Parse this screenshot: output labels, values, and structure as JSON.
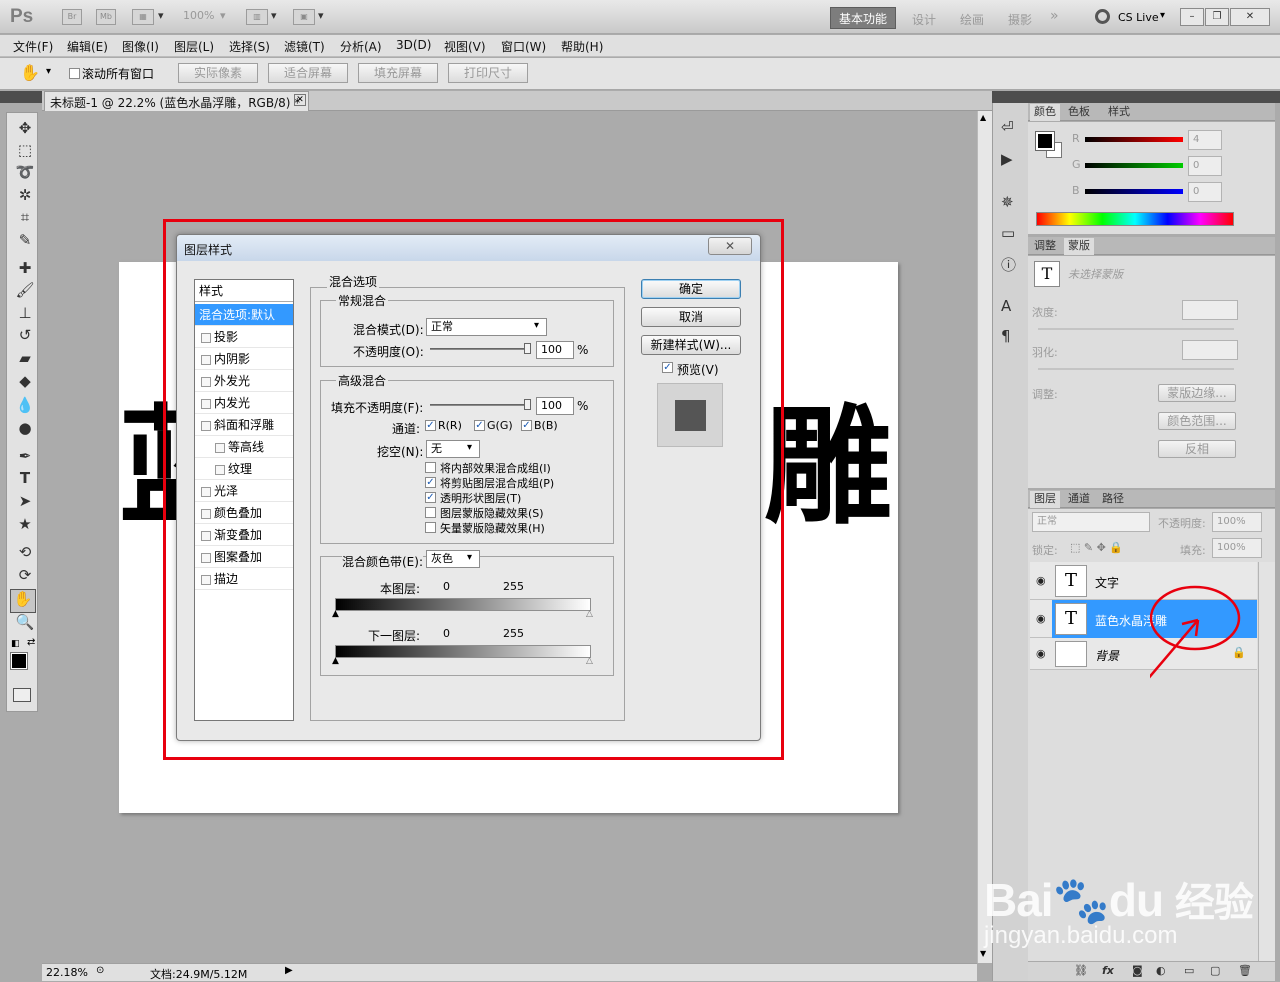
{
  "app": {
    "logo": "Ps",
    "toolbar_icons": [
      "Br",
      "Mb"
    ],
    "zoom": "100%",
    "workspaces": {
      "active": "基本功能",
      "others": [
        "设计",
        "绘画",
        "摄影",
        "»"
      ]
    },
    "cslive": "CS Live",
    "window_buttons": [
      "–",
      "❐",
      "✕"
    ]
  },
  "menu": [
    "文件(F)",
    "编辑(E)",
    "图像(I)",
    "图层(L)",
    "选择(S)",
    "滤镜(T)",
    "分析(A)",
    "3D(D)",
    "视图(V)",
    "窗口(W)",
    "帮助(H)"
  ],
  "options": {
    "scroll_all": "滚动所有窗口",
    "buttons": [
      "实际像素",
      "适合屏幕",
      "填充屏幕",
      "打印尺寸"
    ]
  },
  "document": {
    "tab": "未标题-1 @ 22.2% (蓝色水晶浮雕，RGB/8) *",
    "canvas_text_left": "蓝",
    "canvas_text_right": "雕",
    "status_zoom": "22.18%",
    "status_doc": "文档:24.9M/5.12M"
  },
  "dialog": {
    "title": "图层样式",
    "close": "✕",
    "styles_header": "样式",
    "styles": [
      {
        "label": "混合选项:默认",
        "selected": true,
        "check": false,
        "indent": false
      },
      {
        "label": "投影",
        "check": true,
        "indent": false
      },
      {
        "label": "内阴影",
        "check": true,
        "indent": false
      },
      {
        "label": "外发光",
        "check": true,
        "indent": false
      },
      {
        "label": "内发光",
        "check": true,
        "indent": false
      },
      {
        "label": "斜面和浮雕",
        "check": true,
        "indent": false
      },
      {
        "label": "等高线",
        "check": true,
        "indent": true
      },
      {
        "label": "纹理",
        "check": true,
        "indent": true
      },
      {
        "label": "光泽",
        "check": true,
        "indent": false
      },
      {
        "label": "颜色叠加",
        "check": true,
        "indent": false
      },
      {
        "label": "渐变叠加",
        "check": true,
        "indent": false
      },
      {
        "label": "图案叠加",
        "check": true,
        "indent": false
      },
      {
        "label": "描边",
        "check": true,
        "indent": false
      }
    ],
    "blend_options": "混合选项",
    "general": "常规混合",
    "blend_mode_label": "混合模式(D):",
    "blend_mode_value": "正常",
    "opacity_label": "不透明度(O):",
    "opacity_value": "100",
    "pct": "%",
    "advanced": "高级混合",
    "fill_label": "填充不透明度(F):",
    "fill_value": "100",
    "channels_label": "通道:",
    "channels": [
      "R(R)",
      "G(G)",
      "B(B)"
    ],
    "knockout_label": "挖空(N):",
    "knockout_value": "无",
    "options_checks": [
      {
        "label": "将内部效果混合成组(I)",
        "checked": false
      },
      {
        "label": "将剪贴图层混合成组(P)",
        "checked": true
      },
      {
        "label": "透明形状图层(T)",
        "checked": true
      },
      {
        "label": "图层蒙版隐藏效果(S)",
        "checked": false
      },
      {
        "label": "矢量蒙版隐藏效果(H)",
        "checked": false
      }
    ],
    "blend_if_label": "混合颜色带(E):",
    "blend_if_value": "灰色",
    "this_layer": "本图层:",
    "underlying": "下一图层:",
    "range_min": "0",
    "range_max": "255",
    "ok": "确定",
    "cancel": "取消",
    "new_style": "新建样式(W)...",
    "preview": "预览(V)"
  },
  "color_panel": {
    "tabs": [
      "颜色",
      "色板",
      "样式"
    ],
    "r_label": "R",
    "g_label": "G",
    "b_label": "B",
    "r_value": "4",
    "g_value": "0",
    "b_value": "0"
  },
  "masks_panel": {
    "tabs": [
      "调整",
      "蒙版"
    ],
    "no_mask": "未选择蒙版",
    "density": "浓度:",
    "feather": "羽化:",
    "refine": "调整:",
    "mask_edge": "蒙版边缘...",
    "color_range": "颜色范围...",
    "invert": "反相"
  },
  "layers_panel": {
    "tabs": [
      "图层",
      "通道",
      "路径"
    ],
    "blend": "正常",
    "opacity_label": "不透明度:",
    "opacity_value": "100%",
    "lock_label": "锁定:",
    "fill_label": "填充:",
    "fill_value": "100%",
    "layers": [
      {
        "name": "文字",
        "thumb": "T",
        "selected": false
      },
      {
        "name": "蓝色水晶浮雕",
        "thumb": "T",
        "selected": true
      },
      {
        "name": "背景",
        "thumb": "",
        "selected": false
      }
    ],
    "footer_icons": [
      "link-icon",
      "fx-icon",
      "mask-icon",
      "adjustment-icon",
      "group-icon",
      "new-layer-icon",
      "trash-icon"
    ]
  },
  "watermark": {
    "brand": "Bai",
    "brand2": "du",
    "cn": "经验",
    "url": "jingyan.baidu.com"
  },
  "colors": {
    "highlight": "#e8000e",
    "selection": "#3399ff"
  }
}
